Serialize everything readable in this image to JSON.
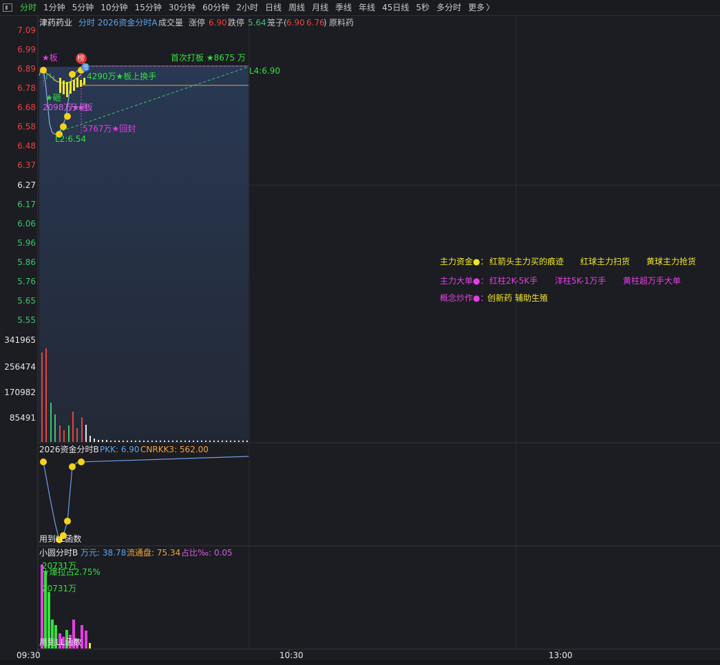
{
  "toolbar": {
    "items": [
      "分时",
      "1分钟",
      "5分钟",
      "10分钟",
      "15分钟",
      "30分钟",
      "60分钟",
      "2小时",
      "日线",
      "周线",
      "月线",
      "季线",
      "年线",
      "45日线",
      "5秒",
      "多分时",
      "更多"
    ],
    "active_index": 0,
    "more_arrow": "〉"
  },
  "header": {
    "stock_name": "津药药业",
    "indicator": "分时 2026资金分时A",
    "volume_label": "成交量",
    "limit_up_label": "涨停",
    "limit_up_value": "6.90",
    "limit_down_label": "跌停",
    "limit_down_value": "5.64",
    "cage_label": "笼子(",
    "cage_value1": "6.90",
    "cage_value2": "6.76",
    "cage_close": ")",
    "concept": "原料药"
  },
  "price_axis": [
    "7.09",
    "6.99",
    "6.89",
    "6.78",
    "6.68",
    "6.58",
    "6.48",
    "6.37",
    "6.27",
    "6.17",
    "6.06",
    "5.96",
    "5.86",
    "5.76",
    "5.65",
    "5.55"
  ],
  "volume_axis": [
    "341965",
    "256474",
    "170982",
    "85491"
  ],
  "chart_annotations": {
    "board_star": "★板",
    "rank_badge": "榜",
    "limit_badge": "涨",
    "first_board": "首次打板 ★8675 万",
    "board_turnover": "4290万★板上换手",
    "l4": "L4:6.90",
    "smash_star": "★砸",
    "smash_amount": "2098万★砸",
    "board2": "万★板",
    "reseal": "5767万★回封",
    "l2": "L2:6.54"
  },
  "legend": {
    "row1_title": "主力资金●：",
    "row1_items": [
      "红箭头主力买的痕迹",
      "红球主力扫货",
      "黄球主力抢货"
    ],
    "row2_title": "主力大单●：",
    "row2_items": [
      "红柱2K-5K手",
      "洋柱5K-1万手",
      "黄柱超万手大单"
    ],
    "row3_title": "概念炒作●：",
    "row3_items": [
      "创新药",
      "辅助生殖"
    ]
  },
  "panel_b": {
    "title": "2026资金分时B",
    "pkk": "PKK: 6.90",
    "cnrkk": "CNRKK3: 562.00",
    "footer": "用到LL函数"
  },
  "panel_c": {
    "title": "小圆分时B",
    "wanyuan": "万元: 38.78",
    "float": "流通盘: 75.34",
    "ratio": "占比‰: 0.05",
    "top_amount": "20731万",
    "burst": "★爆拉占2.75%",
    "amount2": "20731万",
    "footer": "用到LL函数"
  },
  "time_axis": [
    "09:30",
    "10:30",
    "13:00"
  ],
  "colors": {
    "up": "#e8423e",
    "down": "#3ec46d",
    "accent": "#3fd04a",
    "bg": "#1c1d22"
  }
}
